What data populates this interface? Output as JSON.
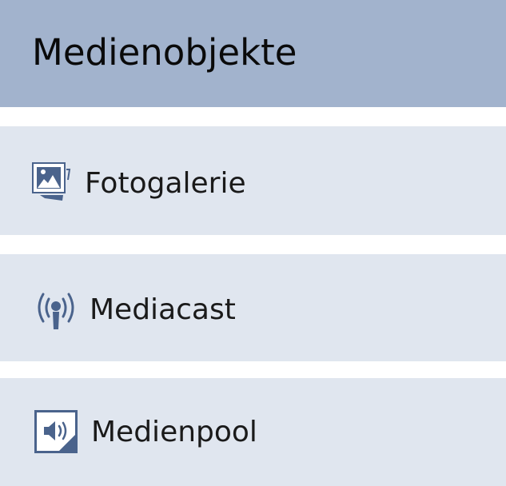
{
  "header": {
    "title": "Medienobjekte"
  },
  "items": [
    {
      "label": "Fotogalerie",
      "icon": "photo-gallery-icon"
    },
    {
      "label": "Mediacast",
      "icon": "broadcast-icon"
    },
    {
      "label": "Medienpool",
      "icon": "audio-file-icon"
    }
  ],
  "colors": {
    "header_bg": "#a2b3cd",
    "item_bg": "#e0e6ef",
    "icon": "#4a638c"
  }
}
